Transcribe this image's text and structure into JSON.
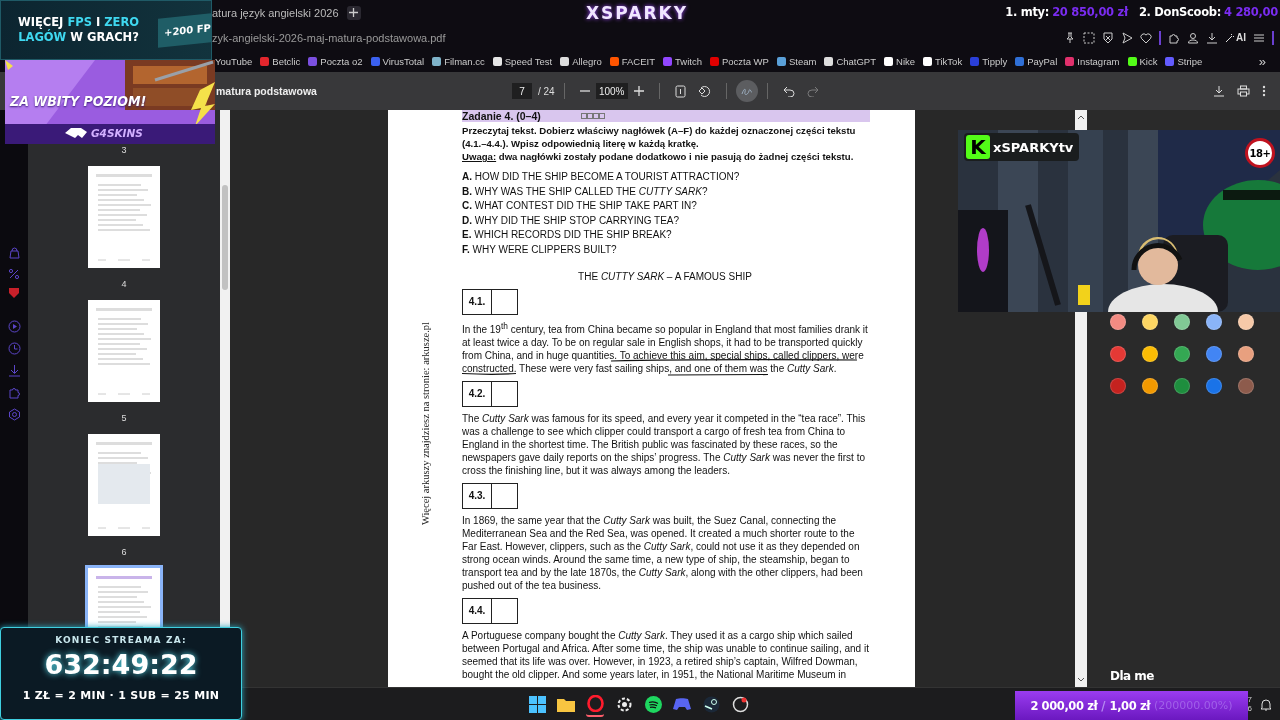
{
  "ad": {
    "headline_lines": [
      [
        {
          "text": "WIĘCEJ ",
          "highlight": false
        },
        {
          "text": "FPS",
          "highlight": true
        },
        {
          "text": " I ",
          "highlight": false
        },
        {
          "text": "ZERO",
          "highlight": true
        }
      ],
      [
        {
          "text": "LAGÓW",
          "highlight": true
        },
        {
          "text": " W GRACH?",
          "highlight": false
        }
      ]
    ],
    "badge": "+200 FP",
    "slogan": "ZA WBITY POZIOM!",
    "brand": "G4SKINS"
  },
  "stream_logo": "XSPARKY",
  "top_donors": [
    {
      "name": "1. mty:",
      "amount": "20 850,00 zł"
    },
    {
      "name": "2. DonScoob:",
      "amount": "4 280,00"
    }
  ],
  "tab": {
    "title": "atura język angielski 2026"
  },
  "address": "zyk-angielski-2026-maj-matura-podstawowa.pdf",
  "ai_label": "AI",
  "bookmarks": [
    {
      "label": "YouTube"
    },
    {
      "label": "Betclic",
      "color": "#e3262d"
    },
    {
      "label": "Poczta o2",
      "color": "#7b4fe0"
    },
    {
      "label": "VirusTotal",
      "color": "#3b61f0"
    },
    {
      "label": "Filman.cc",
      "color": "#7fb3c9"
    },
    {
      "label": "Speed Test",
      "color": "#e6e6e6"
    },
    {
      "label": "Allegro",
      "color": "#dddddd"
    },
    {
      "label": "FACEIT",
      "color": "#ff5500"
    },
    {
      "label": "Twitch",
      "color": "#9146ff"
    },
    {
      "label": "Poczta WP",
      "color": "#e00000"
    },
    {
      "label": "Steam",
      "color": "#5aa0d8"
    },
    {
      "label": "ChatGPT",
      "color": "#dddddd"
    },
    {
      "label": "Nike",
      "color": "#ffffff"
    },
    {
      "label": "TikTok",
      "color": "#ffffff"
    },
    {
      "label": "Tipply",
      "color": "#2a3fd8"
    },
    {
      "label": "PayPal",
      "color": "#2f6fd6"
    },
    {
      "label": "Instagram",
      "color": "#e1306c"
    },
    {
      "label": "Kick",
      "color": "#53fc18"
    },
    {
      "label": "Stripe",
      "color": "#635bff"
    }
  ],
  "bookmarks_more": "»",
  "pdf_toolbar": {
    "title": "matura podstawowa",
    "page": "7",
    "page_count": "/ 24",
    "zoom": "100%",
    "draw_selected": true,
    "redo_disabled": true
  },
  "thumbnails": [
    {
      "kind": "cut",
      "label": "3",
      "selected": false
    },
    {
      "kind": "page",
      "label": "4",
      "selected": false
    },
    {
      "kind": "page",
      "label": "5",
      "selected": false
    },
    {
      "kind": "page",
      "label": "6",
      "selected": false
    },
    {
      "kind": "page",
      "selected": true
    }
  ],
  "document": {
    "side_note": "Więcej arkuszy znajdziesz na stronie: arkusze.pl",
    "task_title": "Zadanie 4. (0–4)",
    "instruction": "Przeczytaj tekst. Dobierz właściwy nagłówek (A–F) do każdej oznaczonej części tekstu (4.1.–4.4.). Wpisz odpowiednią literę w każdą kratkę.",
    "note_label": "Uwaga:",
    "note": "dwa nagłówki zostały podane dodatkowo i nie pasują do żadnej części tekstu.",
    "headings": [
      {
        "letter": "A.",
        "text": "HOW DID THE SHIP BECOME A TOURIST ATTRACTION?"
      },
      {
        "letter": "B.",
        "text": "WHY WAS THE SHIP CALLED THE *CUTTY SARK*?"
      },
      {
        "letter": "C.",
        "text": "WHAT CONTEST DID THE SHIP TAKE PART IN?"
      },
      {
        "letter": "D.",
        "text": "WHY DID THE SHIP STOP CARRYING TEA?"
      },
      {
        "letter": "E.",
        "text": "WHICH RECORDS DID THE SHIP BREAK?"
      },
      {
        "letter": "F.",
        "text": "WHY WERE CLIPPERS BUILT?"
      }
    ],
    "title": "THE *CUTTY SARK* – A FAMOUS SHIP",
    "sections": [
      {
        "number": "4.1.",
        "ink_underline": true,
        "text": "In the 19$^{th}$ century, tea from China became so popular in England that most families drank it at least twice a day. To be on regular sale in English shops, it had to be transported quickly from China, and in huge quantities. To achieve this aim, special ships, called clippers, were constructed. These were very fast sailing ships, and one of them was the *Cutty Sark*."
      },
      {
        "number": "4.2.",
        "text": "The *Cutty Sark* was famous for its speed, and every year it competed in the “tea race”. This was a challenge to see which clipper could transport a cargo of fresh tea from China to England in the shortest time. The British public was fascinated by these races, so the newspapers gave daily reports on the ships’ progress. The *Cutty Sark* was never the first to cross the finishing line, but it was always among the leaders."
      },
      {
        "number": "4.3.",
        "text": "In 1869, the same year that the *Cutty Sark* was built, the Suez Canal, connecting the Mediterranean Sea and the Red Sea, was opened. It created a much shorter route to the Far East. However, clippers, such as the *Cutty Sark*, could not use it as they depended on strong ocean winds. Around the same time, a new type of ship, the steamship, began to transport tea and by the late 1870s, the *Cutty Sark*, along with the other clippers, had been pushed out of the tea business."
      },
      {
        "number": "4.4.",
        "text": "A Portuguese company bought the *Cutty Sark*. They used it as a cargo ship which sailed between Portugal and Africa. After some time, the ship was unable to continue sailing, and it seemed that its life was over. However, in 1923, a retired ship’s captain, Wilfred Dowman, bought the old clipper. And some years later, in 1951, the National Maritime Museum in"
      }
    ]
  },
  "palette": [
    {
      "color": "#f28b82"
    },
    {
      "color": "#fdd663"
    },
    {
      "color": "#81c995"
    },
    {
      "color": "#8ab4f8"
    },
    {
      "color": "#f6c9a8"
    },
    {
      "color": "#e53935"
    },
    {
      "color": "#fbbc04"
    },
    {
      "color": "#34a853"
    },
    {
      "color": "#4285f4"
    },
    {
      "color": "#e8a07f"
    },
    {
      "color": "#c5221f"
    },
    {
      "color": "#f29900"
    },
    {
      "color": "#1e8e3e"
    },
    {
      "color": "#1a73e8"
    },
    {
      "color": "#8d5b4c"
    }
  ],
  "webcam": {
    "logo_letter": "K",
    "channel": "xSPARKYtv",
    "age_badge": "18+"
  },
  "chat_line": "Dla me",
  "timer": {
    "label": "KONIEC STREAMA ZA:",
    "time": "632:49:22",
    "rates": "1 ZŁ = 2 MIN · 1 SUB = 25 MIN"
  },
  "goal": {
    "target": "2 000,00 zł",
    "separator": "/",
    "current": "1,00 zł",
    "percent": "(200000.00%)",
    "level": 1
  },
  "taskbar": {
    "apps": [
      {
        "kind": "start",
        "active": false
      },
      {
        "kind": "folder",
        "active": false
      },
      {
        "kind": "ring",
        "active": true
      },
      {
        "kind": "gear",
        "active": false
      },
      {
        "kind": "waves",
        "active": false
      },
      {
        "kind": "controller",
        "active": false
      },
      {
        "kind": "piston",
        "active": false
      },
      {
        "kind": "record",
        "active": false
      }
    ],
    "tray": [
      "7",
      "6"
    ]
  }
}
